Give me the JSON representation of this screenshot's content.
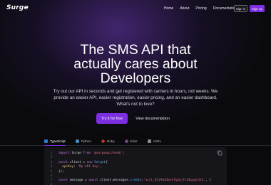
{
  "header": {
    "logo": "Surge",
    "nav": [
      "Home",
      "About",
      "Pricing",
      "Documentation"
    ],
    "sign_in": "Sign in",
    "sign_up": "Sign up"
  },
  "hero": {
    "title_lines": [
      "The SMS API that",
      "actually cares about",
      "Developers"
    ],
    "subtitle": "Try out our API in seconds and get registered with carriers in hours, not weeks. We provide an easier API, easier registration, easier pricing, and an easier dashboard. What's not to love?",
    "primary_cta": "Try it for free",
    "secondary_cta": "View documentation"
  },
  "code_tabs": [
    {
      "label": "TypeScript",
      "active": true,
      "icon": "typescript-icon",
      "color": "#3178c6"
    },
    {
      "label": "Python",
      "active": false,
      "icon": "python-icon",
      "color": "#4b8bbe"
    },
    {
      "label": "Ruby",
      "active": false,
      "icon": "ruby-icon",
      "color": "#cc342d"
    },
    {
      "label": "Elixir",
      "active": false,
      "icon": "elixir-icon",
      "color": "#6e4a7e"
    },
    {
      "label": "cURL",
      "active": false,
      "icon": "curl-icon",
      "color": "#8a8a96"
    }
  ],
  "code": {
    "line_numbers": [
      "1",
      "2",
      "3",
      "4",
      "5",
      "6",
      "7",
      "8"
    ],
    "l1": {
      "kw1": "import",
      "name": " Surge ",
      "kw2": "from",
      "str": " '@surgeapi/node'",
      "end": ";"
    },
    "l3": {
      "kw": "const",
      "rest": " client = ",
      "kw2": "new",
      "fn": " Surge",
      "end": "({"
    },
    "l4": {
      "prop": "  apiKey",
      "rest": ": ",
      "str": "'My API Key'",
      "end": ","
    },
    "l5": {
      "text": "});"
    },
    "l7": {
      "kw": "const",
      "rest": " message = ",
      "kw2": "await",
      "rest2": " client.messages.",
      "fn": "create",
      "str": "('acct_01j9a43avnfqzbjfch6pygv1ta'",
      "end": ", {"
    }
  },
  "colors": {
    "accent": "#7c2fe0",
    "background": "#0a0a0c",
    "code_bg": "#15151a"
  }
}
